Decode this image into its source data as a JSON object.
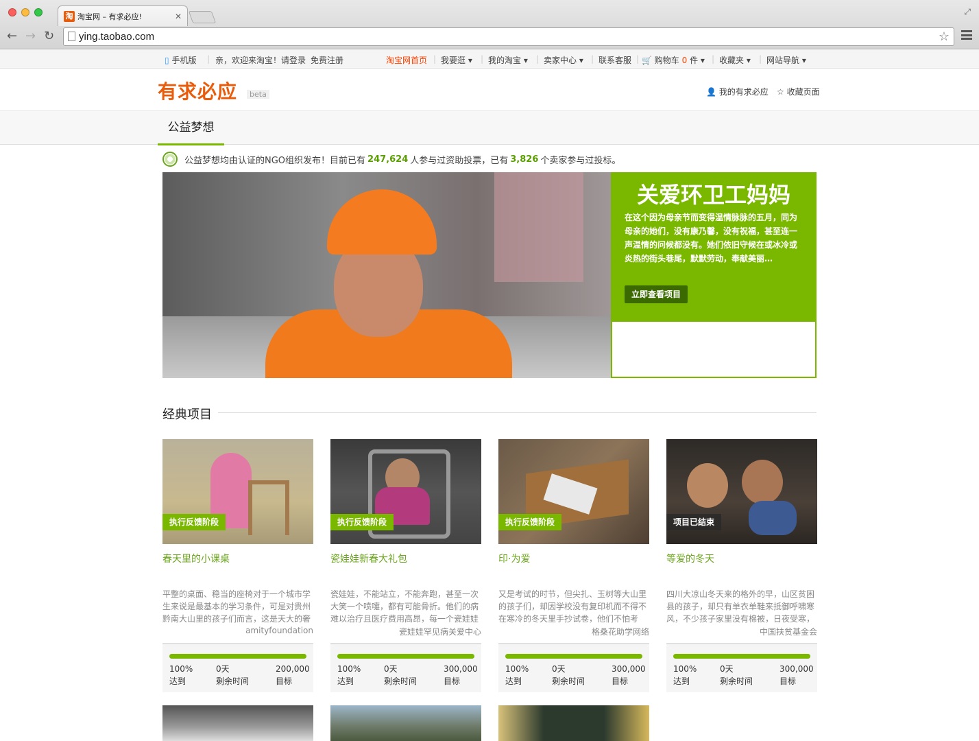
{
  "browser": {
    "tab_title": "淘宝网 – 有求必应!",
    "favicon_text": "淘",
    "url": "ying.taobao.com"
  },
  "sitebar": {
    "mobile": "手机版",
    "welcome": "亲，欢迎来淘宝！",
    "login": "请登录",
    "register": "免费注册",
    "home": "淘宝网首页",
    "shop": "我要逛",
    "my_taobao": "我的淘宝",
    "seller": "卖家中心",
    "service": "联系客服",
    "cart_label": "购物车",
    "cart_count": "0",
    "cart_unit": "件",
    "favorites": "收藏夹",
    "site_nav": "网站导航"
  },
  "header": {
    "logo": "有求必应",
    "beta": "beta",
    "my_link": "我的有求必应",
    "bookmark": "收藏页面"
  },
  "nav": {
    "active_tab": "公益梦想"
  },
  "notice": {
    "text1": "公益梦想均由认证的NGO组织发布！目前已有",
    "participants": "247,624",
    "text2": "人参与过资助投票，已有",
    "sellers": "3,826",
    "text3": "个卖家参与过投标。"
  },
  "hero": {
    "title": "关爱环卫工妈妈",
    "text": "在这个因为母亲节而变得温情脉脉的五月，同为母亲的她们，没有康乃馨，没有祝福，甚至连一声温情的问候都没有。她们依旧守候在或冰冷或炎热的街头巷尾，默默劳动，奉献美丽…",
    "button": "立即查看项目"
  },
  "section": {
    "title": "经典项目"
  },
  "cards": [
    {
      "badge": "执行反馈阶段",
      "title": "春天里的小课桌",
      "desc": "平整的桌面、稳当的座椅对于一个城市学生来说是最基本的学习条件，可是对贵州黔南大山里的孩子们而言，这是天大的奢",
      "org": "amityfoundation",
      "reached": "100%",
      "reached_label": "达到",
      "remaining": "0天",
      "remaining_label": "剩余时间",
      "goal": "200,000",
      "goal_label": "目标",
      "progress": 1.0
    },
    {
      "badge": "执行反馈阶段",
      "title": "瓷娃娃新春大礼包",
      "desc": "瓷娃娃，不能站立，不能奔跑，甚至一次大笑一个喷嚏，都有可能骨折。他们的病难以治疗且医疗费用高昂，每一个瓷娃娃",
      "org": "瓷娃娃罕见病关爱中心",
      "reached": "100%",
      "reached_label": "达到",
      "remaining": "0天",
      "remaining_label": "剩余时间",
      "goal": "300,000",
      "goal_label": "目标",
      "progress": 1.0
    },
    {
      "badge": "执行反馈阶段",
      "title": "印·为爱",
      "desc": "又是考试的时节，但尖扎、玉树等大山里的孩子们，却因学校没有复印机而不得不在寒冷的冬天里手抄试卷，他们不怕考",
      "org": "格桑花助学网络",
      "reached": "100%",
      "reached_label": "达到",
      "remaining": "0天",
      "remaining_label": "剩余时间",
      "goal": "300,000",
      "goal_label": "目标",
      "progress": 1.0
    },
    {
      "badge": "项目已结束",
      "title": "等爱的冬天",
      "desc": "四川大凉山冬天来的格外的早，山区贫困县的孩子，却只有单衣单鞋来抵御呼啸寒风，不少孩子家里没有棉被，日夜受寒，",
      "org": "中国扶贫基金会",
      "reached": "100%",
      "reached_label": "达到",
      "remaining": "0天",
      "remaining_label": "剩余时间",
      "goal": "300,000",
      "goal_label": "目标",
      "progress": 1.0
    }
  ],
  "colors": {
    "accent": "#7ab800",
    "taobao_orange": "#ff4400",
    "logo": "#e85d0c"
  }
}
